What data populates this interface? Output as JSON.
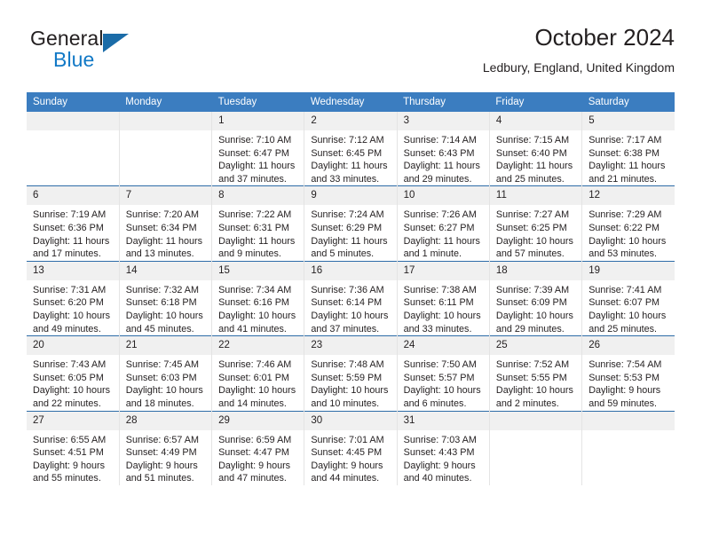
{
  "brand": {
    "name_top": "General",
    "name_bottom": "Blue",
    "triangle_color": "#1b6ca8",
    "blue_text_color": "#1279c6"
  },
  "header": {
    "title": "October 2024",
    "subtitle": "Ledbury, England, United Kingdom"
  },
  "colors": {
    "header_bar": "#3b7dc0",
    "row_rule": "#2d6ca8",
    "date_band": "#f0f0f0",
    "text": "#231f20"
  },
  "weekdays": [
    "Sunday",
    "Monday",
    "Tuesday",
    "Wednesday",
    "Thursday",
    "Friday",
    "Saturday"
  ],
  "weeks": [
    [
      {
        "date": "",
        "sunrise": "",
        "sunset": "",
        "daylight_1": "",
        "daylight_2": ""
      },
      {
        "date": "",
        "sunrise": "",
        "sunset": "",
        "daylight_1": "",
        "daylight_2": ""
      },
      {
        "date": "1",
        "sunrise": "Sunrise: 7:10 AM",
        "sunset": "Sunset: 6:47 PM",
        "daylight_1": "Daylight: 11 hours",
        "daylight_2": "and 37 minutes."
      },
      {
        "date": "2",
        "sunrise": "Sunrise: 7:12 AM",
        "sunset": "Sunset: 6:45 PM",
        "daylight_1": "Daylight: 11 hours",
        "daylight_2": "and 33 minutes."
      },
      {
        "date": "3",
        "sunrise": "Sunrise: 7:14 AM",
        "sunset": "Sunset: 6:43 PM",
        "daylight_1": "Daylight: 11 hours",
        "daylight_2": "and 29 minutes."
      },
      {
        "date": "4",
        "sunrise": "Sunrise: 7:15 AM",
        "sunset": "Sunset: 6:40 PM",
        "daylight_1": "Daylight: 11 hours",
        "daylight_2": "and 25 minutes."
      },
      {
        "date": "5",
        "sunrise": "Sunrise: 7:17 AM",
        "sunset": "Sunset: 6:38 PM",
        "daylight_1": "Daylight: 11 hours",
        "daylight_2": "and 21 minutes."
      }
    ],
    [
      {
        "date": "6",
        "sunrise": "Sunrise: 7:19 AM",
        "sunset": "Sunset: 6:36 PM",
        "daylight_1": "Daylight: 11 hours",
        "daylight_2": "and 17 minutes."
      },
      {
        "date": "7",
        "sunrise": "Sunrise: 7:20 AM",
        "sunset": "Sunset: 6:34 PM",
        "daylight_1": "Daylight: 11 hours",
        "daylight_2": "and 13 minutes."
      },
      {
        "date": "8",
        "sunrise": "Sunrise: 7:22 AM",
        "sunset": "Sunset: 6:31 PM",
        "daylight_1": "Daylight: 11 hours",
        "daylight_2": "and 9 minutes."
      },
      {
        "date": "9",
        "sunrise": "Sunrise: 7:24 AM",
        "sunset": "Sunset: 6:29 PM",
        "daylight_1": "Daylight: 11 hours",
        "daylight_2": "and 5 minutes."
      },
      {
        "date": "10",
        "sunrise": "Sunrise: 7:26 AM",
        "sunset": "Sunset: 6:27 PM",
        "daylight_1": "Daylight: 11 hours",
        "daylight_2": "and 1 minute."
      },
      {
        "date": "11",
        "sunrise": "Sunrise: 7:27 AM",
        "sunset": "Sunset: 6:25 PM",
        "daylight_1": "Daylight: 10 hours",
        "daylight_2": "and 57 minutes."
      },
      {
        "date": "12",
        "sunrise": "Sunrise: 7:29 AM",
        "sunset": "Sunset: 6:22 PM",
        "daylight_1": "Daylight: 10 hours",
        "daylight_2": "and 53 minutes."
      }
    ],
    [
      {
        "date": "13",
        "sunrise": "Sunrise: 7:31 AM",
        "sunset": "Sunset: 6:20 PM",
        "daylight_1": "Daylight: 10 hours",
        "daylight_2": "and 49 minutes."
      },
      {
        "date": "14",
        "sunrise": "Sunrise: 7:32 AM",
        "sunset": "Sunset: 6:18 PM",
        "daylight_1": "Daylight: 10 hours",
        "daylight_2": "and 45 minutes."
      },
      {
        "date": "15",
        "sunrise": "Sunrise: 7:34 AM",
        "sunset": "Sunset: 6:16 PM",
        "daylight_1": "Daylight: 10 hours",
        "daylight_2": "and 41 minutes."
      },
      {
        "date": "16",
        "sunrise": "Sunrise: 7:36 AM",
        "sunset": "Sunset: 6:14 PM",
        "daylight_1": "Daylight: 10 hours",
        "daylight_2": "and 37 minutes."
      },
      {
        "date": "17",
        "sunrise": "Sunrise: 7:38 AM",
        "sunset": "Sunset: 6:11 PM",
        "daylight_1": "Daylight: 10 hours",
        "daylight_2": "and 33 minutes."
      },
      {
        "date": "18",
        "sunrise": "Sunrise: 7:39 AM",
        "sunset": "Sunset: 6:09 PM",
        "daylight_1": "Daylight: 10 hours",
        "daylight_2": "and 29 minutes."
      },
      {
        "date": "19",
        "sunrise": "Sunrise: 7:41 AM",
        "sunset": "Sunset: 6:07 PM",
        "daylight_1": "Daylight: 10 hours",
        "daylight_2": "and 25 minutes."
      }
    ],
    [
      {
        "date": "20",
        "sunrise": "Sunrise: 7:43 AM",
        "sunset": "Sunset: 6:05 PM",
        "daylight_1": "Daylight: 10 hours",
        "daylight_2": "and 22 minutes."
      },
      {
        "date": "21",
        "sunrise": "Sunrise: 7:45 AM",
        "sunset": "Sunset: 6:03 PM",
        "daylight_1": "Daylight: 10 hours",
        "daylight_2": "and 18 minutes."
      },
      {
        "date": "22",
        "sunrise": "Sunrise: 7:46 AM",
        "sunset": "Sunset: 6:01 PM",
        "daylight_1": "Daylight: 10 hours",
        "daylight_2": "and 14 minutes."
      },
      {
        "date": "23",
        "sunrise": "Sunrise: 7:48 AM",
        "sunset": "Sunset: 5:59 PM",
        "daylight_1": "Daylight: 10 hours",
        "daylight_2": "and 10 minutes."
      },
      {
        "date": "24",
        "sunrise": "Sunrise: 7:50 AM",
        "sunset": "Sunset: 5:57 PM",
        "daylight_1": "Daylight: 10 hours",
        "daylight_2": "and 6 minutes."
      },
      {
        "date": "25",
        "sunrise": "Sunrise: 7:52 AM",
        "sunset": "Sunset: 5:55 PM",
        "daylight_1": "Daylight: 10 hours",
        "daylight_2": "and 2 minutes."
      },
      {
        "date": "26",
        "sunrise": "Sunrise: 7:54 AM",
        "sunset": "Sunset: 5:53 PM",
        "daylight_1": "Daylight: 9 hours",
        "daylight_2": "and 59 minutes."
      }
    ],
    [
      {
        "date": "27",
        "sunrise": "Sunrise: 6:55 AM",
        "sunset": "Sunset: 4:51 PM",
        "daylight_1": "Daylight: 9 hours",
        "daylight_2": "and 55 minutes."
      },
      {
        "date": "28",
        "sunrise": "Sunrise: 6:57 AM",
        "sunset": "Sunset: 4:49 PM",
        "daylight_1": "Daylight: 9 hours",
        "daylight_2": "and 51 minutes."
      },
      {
        "date": "29",
        "sunrise": "Sunrise: 6:59 AM",
        "sunset": "Sunset: 4:47 PM",
        "daylight_1": "Daylight: 9 hours",
        "daylight_2": "and 47 minutes."
      },
      {
        "date": "30",
        "sunrise": "Sunrise: 7:01 AM",
        "sunset": "Sunset: 4:45 PM",
        "daylight_1": "Daylight: 9 hours",
        "daylight_2": "and 44 minutes."
      },
      {
        "date": "31",
        "sunrise": "Sunrise: 7:03 AM",
        "sunset": "Sunset: 4:43 PM",
        "daylight_1": "Daylight: 9 hours",
        "daylight_2": "and 40 minutes."
      },
      {
        "date": "",
        "sunrise": "",
        "sunset": "",
        "daylight_1": "",
        "daylight_2": ""
      },
      {
        "date": "",
        "sunrise": "",
        "sunset": "",
        "daylight_1": "",
        "daylight_2": ""
      }
    ]
  ]
}
